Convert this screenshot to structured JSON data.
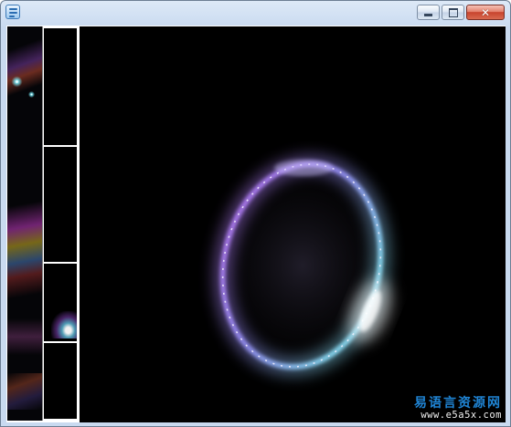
{
  "window": {
    "title": "",
    "icon": "app-logo-icon",
    "controls": {
      "minimize": "minimize-icon",
      "maximize": "maximize-icon",
      "close": "close-icon",
      "close_glyph": "✕"
    }
  },
  "thumbnails": {
    "count": 4,
    "selected": 3
  },
  "preview": {
    "effect": "glowing particle ring",
    "palette": [
      "#b46bff",
      "#8f8cff",
      "#79d6ff",
      "#ffffff"
    ]
  },
  "watermark": {
    "brand": "易语言资源网",
    "url": "www.e5a5x.com"
  }
}
